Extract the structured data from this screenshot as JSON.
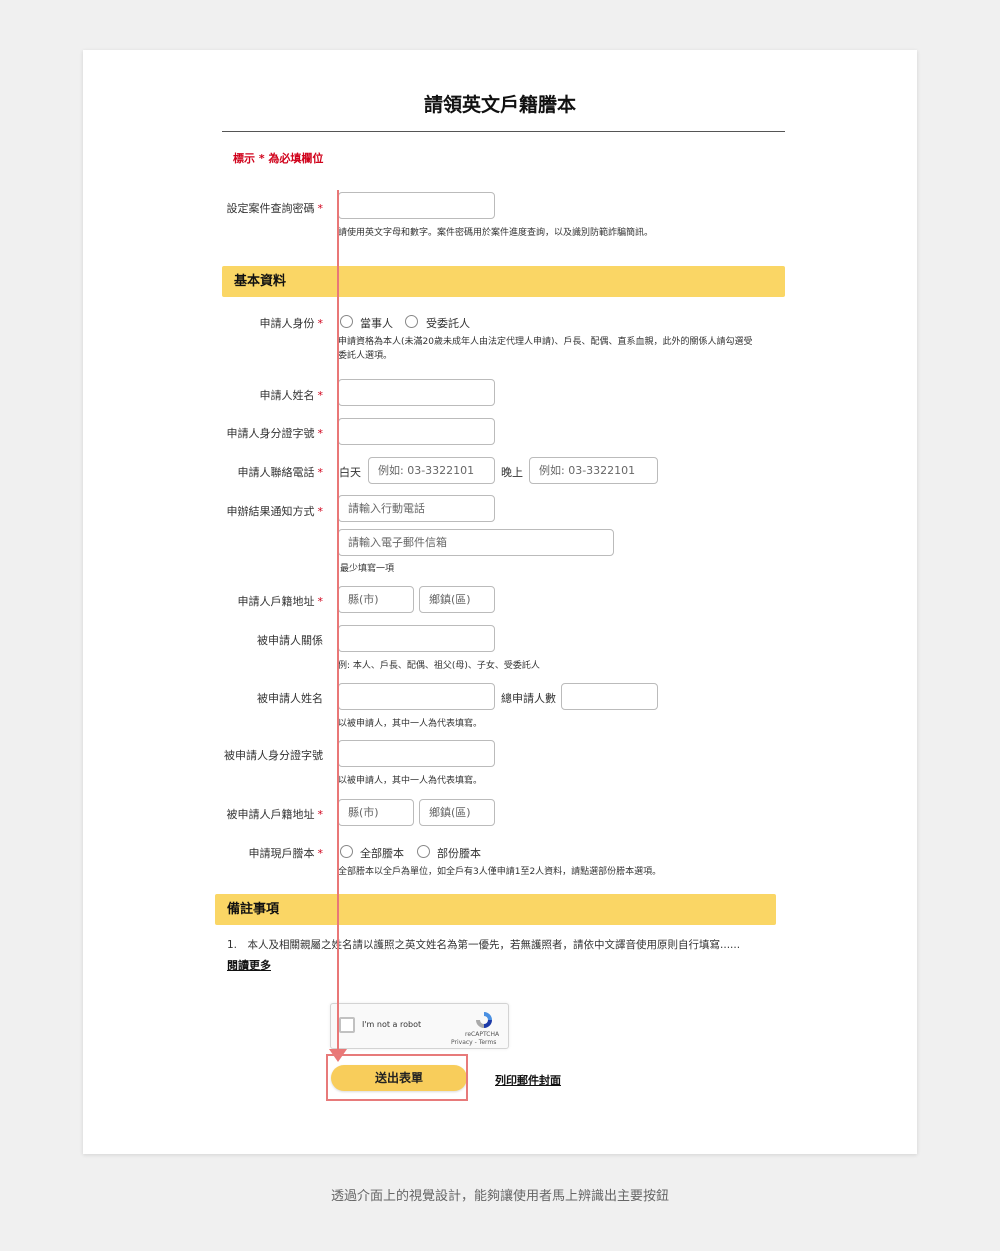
{
  "page_title": "請領英文戶籍謄本",
  "required_note": "標示 * 為必填欄位",
  "required_mark": "*",
  "password": {
    "label": "設定案件查詢密碼",
    "hint": "請使用英文字母和數字。案件密碼用於案件進度查詢，以及識別防範詐騙簡訊。"
  },
  "section_basic": "基本資料",
  "identity": {
    "label": "申請人身份",
    "options": [
      "當事人",
      "受委託人"
    ],
    "hint_line1": "申請資格為本人(未滿20歲未成年人由法定代理人申請)、戶長、配偶、直系血親，此外的關係人請勾選受",
    "hint_line2": "委託人選項。"
  },
  "name_label": "申請人姓名",
  "id_label": "申請人身分證字號",
  "phone": {
    "label": "申請人聯絡電話",
    "day_label": "白天",
    "day_placeholder": "例如: 03-3322101",
    "night_label": "晚上",
    "night_placeholder": "例如: 03-3322101"
  },
  "notify": {
    "label": "申辦結果通知方式",
    "mobile_placeholder": "請輸入行動電話",
    "email_placeholder": "請輸入電子郵件信箱",
    "hint": "最少填寫一項"
  },
  "address": {
    "label": "申請人戶籍地址",
    "county_placeholder": "縣(市)",
    "town_placeholder": "鄉鎮(區)"
  },
  "relation": {
    "label": "被申請人關係",
    "hint": "例: 本人、戶長、配偶、祖父(母)、子女、受委託人"
  },
  "subject_name": {
    "label": "被申請人姓名",
    "count_label": "總申請人數",
    "hint": "以被申請人，其中一人為代表填寫。"
  },
  "subject_id": {
    "label": "被申請人身分證字號",
    "hint": "以被申請人，其中一人為代表填寫。"
  },
  "subject_address": {
    "label": "被申請人戶籍地址",
    "county_placeholder": "縣(市)",
    "town_placeholder": "鄉鎮(區)"
  },
  "copy_type": {
    "label": "申請現戶謄本",
    "options": [
      "全部謄本",
      "部份謄本"
    ],
    "hint": "全部謄本以全戶為單位，如全戶有3人僅申請1至2人資料，請點選部份謄本選項。"
  },
  "section_notes": "備註事項",
  "notes": {
    "item": "1.　本人及相關親屬之姓名請以護照之英文姓名為第一優先，若無護照者，請依中文譯音使用原則自行填寫......",
    "read_more": "閱讀更多"
  },
  "recaptcha": {
    "text": "I'm not a robot",
    "brand": "reCAPTCHA",
    "links": "Privacy - Terms"
  },
  "submit_label": "送出表單",
  "print_label": "列印郵件封面",
  "caption": "透過介面上的視覺設計，能夠讓使用者馬上辨識出主要按鈕",
  "colors": {
    "section_bg": "#fad665",
    "button_bg": "#f8cd5b",
    "required": "#d0021b",
    "annotation": "#e97777"
  }
}
